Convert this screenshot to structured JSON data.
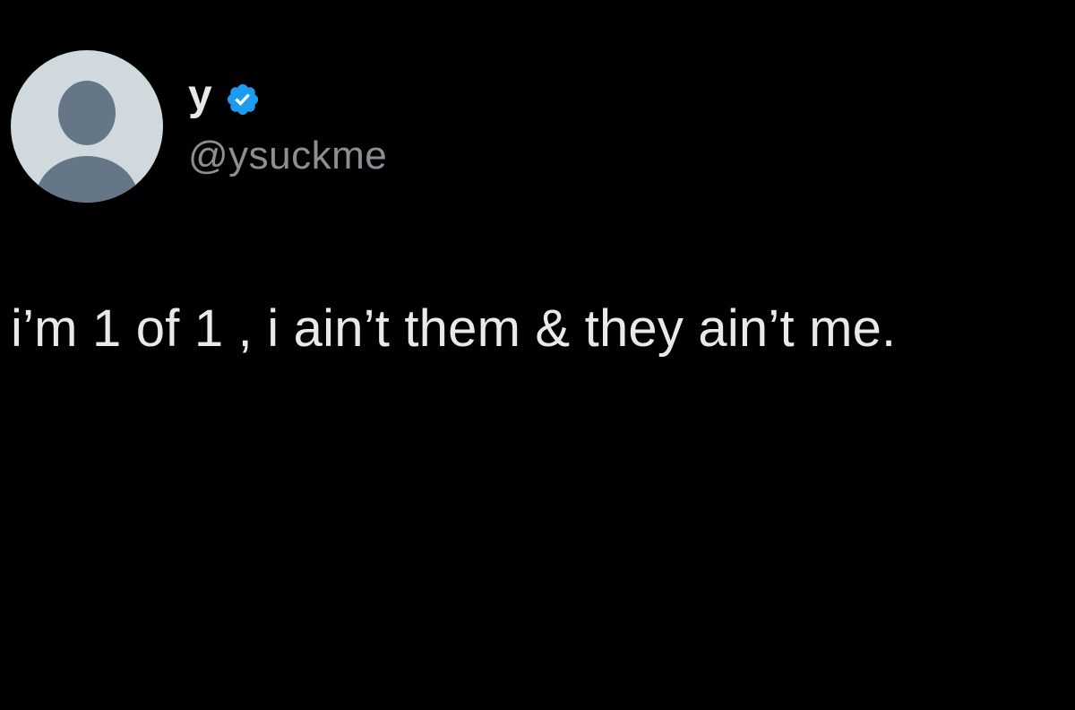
{
  "tweet": {
    "author": {
      "display_name": "y",
      "handle": "@ysuckme",
      "verified": true,
      "verified_badge_color": "#1d9bf0",
      "avatar": "default-profile-silhouette"
    },
    "text": "i’m 1 of 1 , i ain’t them & they ain’t me."
  },
  "theme": {
    "background": "#000000",
    "text_primary": "#e9e9e9",
    "text_secondary": "#8b8e93",
    "avatar_bg": "#cfd9de",
    "avatar_figure": "#657786"
  }
}
